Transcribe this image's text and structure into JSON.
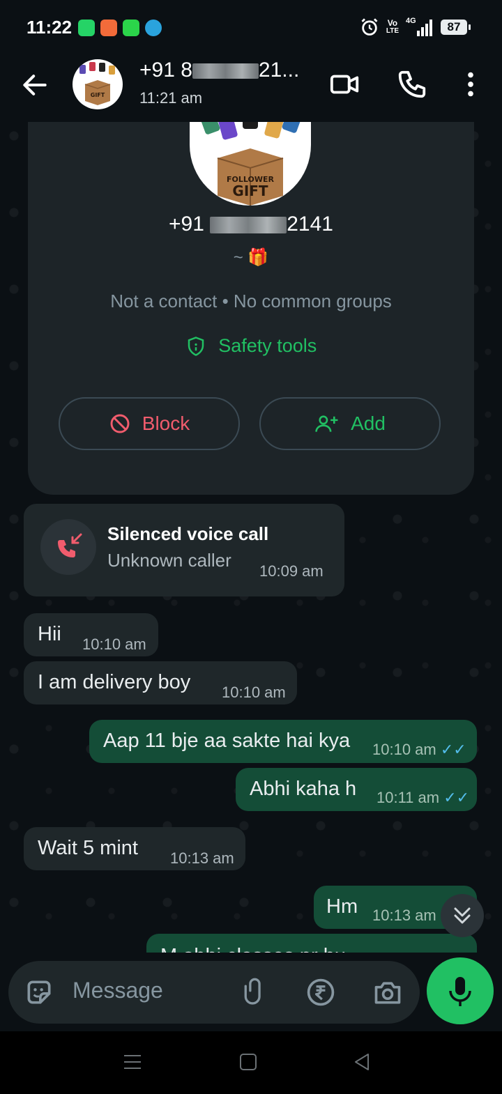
{
  "status_bar": {
    "time": "11:22",
    "network_top": "Vo",
    "network_bottom": "LTE",
    "signal": "4G",
    "battery": "87"
  },
  "header": {
    "name_prefix": "+91 8",
    "name_suffix": "21...",
    "subtitle": "11:21 am"
  },
  "contact_card": {
    "phone_prefix": "+91",
    "phone_suffix": "2141",
    "about": "~ 🎁",
    "meta": "Not a contact • No common groups",
    "safety_label": "Safety tools",
    "block_label": "Block",
    "add_label": "Add",
    "avatar_text_line1": "FOLLOWER",
    "avatar_text_line2": "GIFT"
  },
  "call_bubble": {
    "title": "Silenced voice call",
    "subtitle": "Unknown caller",
    "time": "10:09 am"
  },
  "messages": [
    {
      "dir": "in",
      "text": "Hii",
      "time": "10:10 am"
    },
    {
      "dir": "in",
      "text": "I am delivery boy",
      "time": "10:10 am"
    },
    {
      "dir": "out",
      "text": "Aap 11 bje aa sakte hai kya",
      "time": "10:10 am",
      "ticks": "✓✓"
    },
    {
      "dir": "out",
      "text": "Abhi kaha h",
      "time": "10:11 am",
      "ticks": "✓✓"
    },
    {
      "dir": "in",
      "text": "Wait 5 mint",
      "time": "10:13 am"
    },
    {
      "dir": "out",
      "text": "Hm",
      "time": "10:13 am"
    },
    {
      "dir": "out",
      "text": "M abhi classes pr hu",
      "time": ""
    }
  ],
  "composer": {
    "placeholder": "Message"
  },
  "colors": {
    "accent": "#21c063",
    "outgoing_bubble": "#144d37",
    "incoming_bubble": "#1f272a",
    "block_red": "#f15c6d",
    "read_tick": "#53bdeb"
  }
}
